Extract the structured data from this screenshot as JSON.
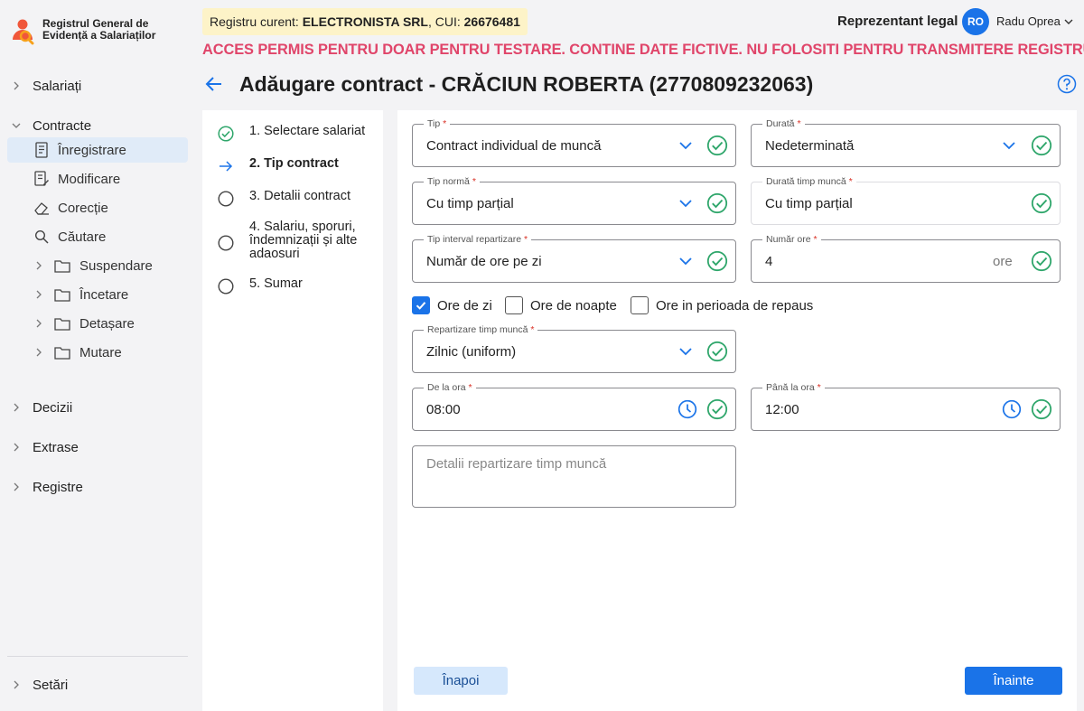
{
  "app": {
    "title": "Registrul General de Evidență a Salariaților"
  },
  "header": {
    "registry_prefix": "Registru curent: ",
    "registry_company": "ELECTRONISTA SRL",
    "registry_cui_prefix": ", CUI: ",
    "registry_cui": "26676481",
    "role": "Reprezentant legal",
    "avatar_initials": "RO",
    "user_name": "Radu Oprea",
    "warning": "ACCES PERMIS PENTRU DOAR PENTRU TESTARE. CONTINE DATE FICTIVE. NU FOLOSITI PENTRU TRANSMITERE REGISTRU"
  },
  "sidebar": {
    "salariati": "Salariați",
    "contracte": "Contracte",
    "inregistrare": "Înregistrare",
    "modificare": "Modificare",
    "corectie": "Corecție",
    "cautare": "Căutare",
    "suspendare": "Suspendare",
    "incetare": "Încetare",
    "detasare": "Detașare",
    "mutare": "Mutare",
    "decizii": "Decizii",
    "extrase": "Extrase",
    "registre": "Registre",
    "setari": "Setări"
  },
  "page": {
    "title": "Adăugare contract - CRĂCIUN ROBERTA (2770809232063)"
  },
  "steps": [
    {
      "label": "1. Selectare salariat",
      "state": "done"
    },
    {
      "label": "2. Tip contract",
      "state": "current"
    },
    {
      "label": "3. Detalii contract",
      "state": "pending"
    },
    {
      "label": "4. Salariu, sporuri, îndemnizații și alte adaosuri",
      "state": "pending"
    },
    {
      "label": "5. Sumar",
      "state": "pending"
    }
  ],
  "form": {
    "tip": {
      "label": "Tip",
      "value": "Contract individual de muncă"
    },
    "durata": {
      "label": "Durată",
      "value": "Nedeterminată"
    },
    "tip_norma": {
      "label": "Tip normă",
      "value": "Cu timp parțial"
    },
    "durata_timp": {
      "label": "Durată timp muncă",
      "value": "Cu timp parțial"
    },
    "tip_interval": {
      "label": "Tip interval repartizare",
      "value": "Număr de ore pe zi"
    },
    "numar_ore": {
      "label": "Număr ore",
      "value": "4",
      "unit": "ore"
    },
    "checkboxes": [
      {
        "label": "Ore de zi",
        "checked": true
      },
      {
        "label": "Ore de noapte",
        "checked": false
      },
      {
        "label": "Ore in perioada de repaus",
        "checked": false
      }
    ],
    "repartizare": {
      "label": "Repartizare timp muncă",
      "value": "Zilnic (uniform)"
    },
    "de_la_ora": {
      "label": "De la ora",
      "value": "08:00"
    },
    "pana_la_ora": {
      "label": "Până la ora",
      "value": "12:00"
    },
    "detalii": {
      "placeholder": "Detalii repartizare timp muncă"
    },
    "required_mark": "*"
  },
  "buttons": {
    "back": "Înapoi",
    "next": "Înainte"
  },
  "colors": {
    "accent": "#1a73e8",
    "success": "#2fa66b",
    "warning_text": "#e0456a",
    "registry_bg": "#fdf3c8",
    "active_nav_bg": "#e0ebf8"
  }
}
